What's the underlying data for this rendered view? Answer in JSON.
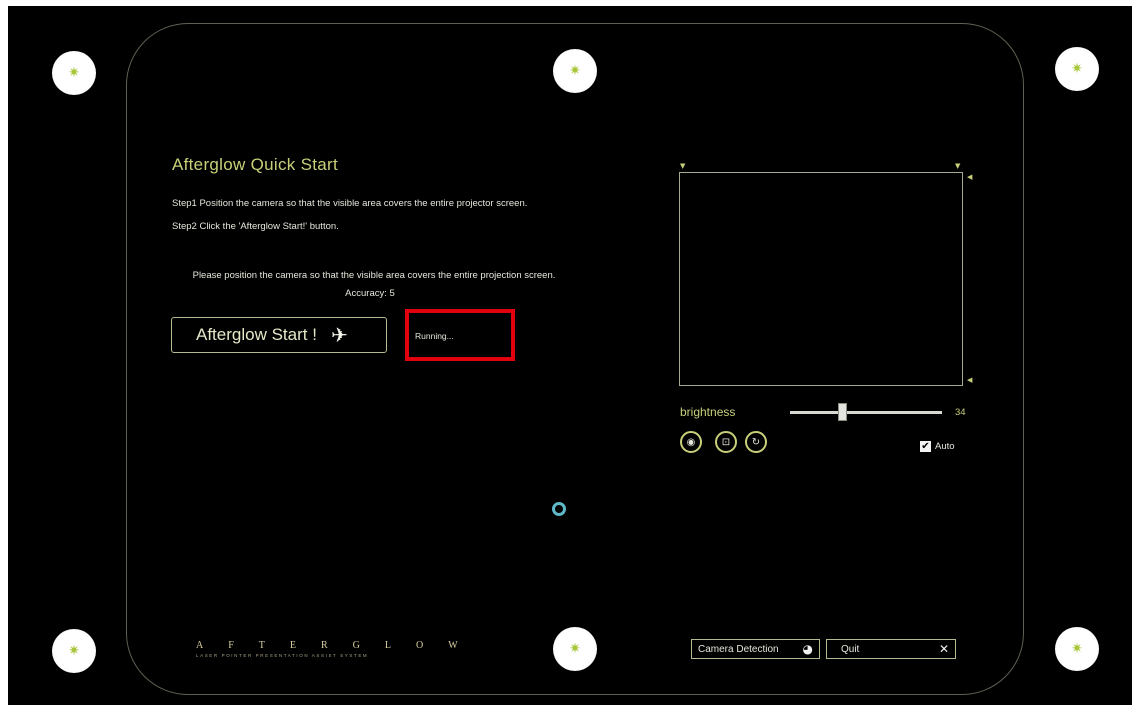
{
  "app": {
    "title": "Afterglow Quick Start",
    "step1": "Step1 Position the camera so that the visible area covers the entire projector screen.",
    "step2": "Step2 Click the 'Afterglow Start!' button.",
    "notice": "Please position the camera so that the visible area covers the entire projection screen.",
    "accuracy": "Accuracy: 5"
  },
  "start_button": {
    "label": "Afterglow Start !",
    "icon": "airplane-icon"
  },
  "status": {
    "running": "Running..."
  },
  "camera": {
    "brightness_label": "brightness",
    "brightness_value": "34",
    "brightness_level": 0.34,
    "auto_label": "Auto",
    "auto_checked": true,
    "tools": [
      "eye-icon",
      "target-icon",
      "refresh-icon"
    ]
  },
  "logo": {
    "word": "AFTERGLOW",
    "tagline": "LASER POINTER PRESENTATION ASSIST SYSTEM"
  },
  "bottom": {
    "camera_detection_label": "Camera Detection",
    "quit_label": "Quit"
  },
  "colors": {
    "accent": "#c9d07a",
    "highlight": "#e3000f",
    "background": "#000000"
  }
}
